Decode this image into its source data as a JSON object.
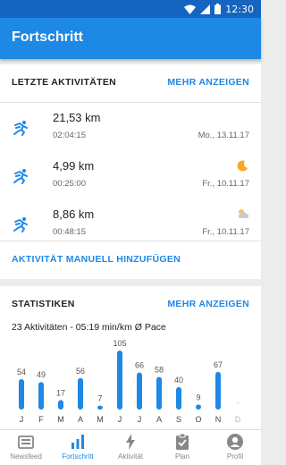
{
  "status_bar": {
    "time": "12:30"
  },
  "header": {
    "title": "Fortschritt"
  },
  "activities": {
    "title": "LETZTE AKTIVITÄTEN",
    "more_label": "MEHR ANZEIGEN",
    "items": [
      {
        "distance": "21,53 km",
        "duration": "02:04:15",
        "date": "Mo., 13.11.17",
        "weather_icon": ""
      },
      {
        "distance": "4,99 km",
        "duration": "00:25:00",
        "date": "Fr., 10.11.17",
        "weather_icon": "moon-icon"
      },
      {
        "distance": "8,86 km",
        "duration": "00:48:15",
        "date": "Fr., 10.11.17",
        "weather_icon": "cloud-icon"
      }
    ],
    "manual_label": "AKTIVITÄT MANUELL HINZUFÜGEN"
  },
  "stats": {
    "title": "STATISTIKEN",
    "more_label": "MEHR ANZEIGEN",
    "summary": "23 Aktivitäten - 05:19 min/km Ø Pace"
  },
  "chart_data": {
    "type": "bar",
    "categories": [
      "J",
      "F",
      "M",
      "A",
      "M",
      "J",
      "J",
      "A",
      "S",
      "O",
      "N",
      "D"
    ],
    "values": [
      54,
      49,
      17,
      56,
      7,
      105,
      66,
      58,
      40,
      9,
      67,
      0
    ],
    "data_labels": [
      "54",
      "49",
      "17",
      "56",
      "7",
      "105",
      "66",
      "58",
      "40",
      "9",
      "67",
      "-"
    ],
    "bar_color": "#1e88e5",
    "inactive_color": "#bbbbbb"
  },
  "navigation": {
    "items": [
      {
        "label": "Newsfeed",
        "icon": "newsfeed-icon",
        "active": false
      },
      {
        "label": "Fortschritt",
        "icon": "bar-chart-icon",
        "active": true
      },
      {
        "label": "Aktivität",
        "icon": "lightning-icon",
        "active": false
      },
      {
        "label": "Plan",
        "icon": "clipboard-icon",
        "active": false
      },
      {
        "label": "Profil",
        "icon": "profile-icon",
        "active": false
      }
    ]
  },
  "colors": {
    "primary": "#1e88e5",
    "status_bar": "#1565c0",
    "moon": "#f9a825"
  }
}
